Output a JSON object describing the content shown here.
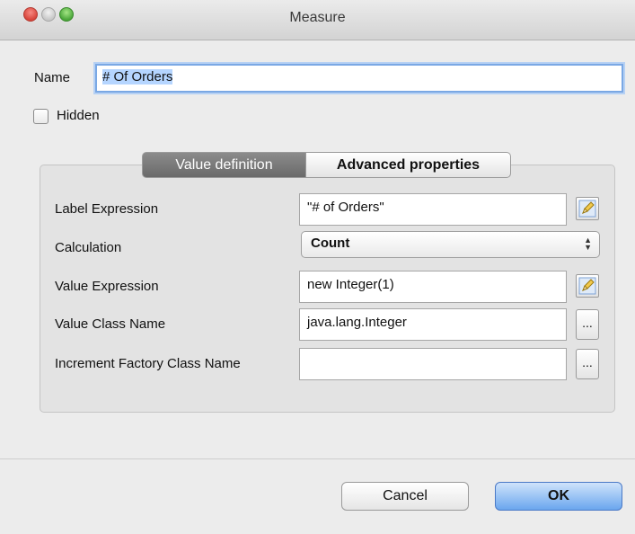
{
  "window": {
    "title": "Measure"
  },
  "name_row": {
    "label": "Name",
    "value": "# Of Orders"
  },
  "hidden": {
    "label": "Hidden",
    "checked": false
  },
  "tabs": [
    {
      "label": "Value definition",
      "active": true
    },
    {
      "label": "Advanced properties",
      "active": false
    }
  ],
  "form": {
    "label_expression": {
      "label": "Label Expression",
      "value": "\"# of Orders\""
    },
    "calculation": {
      "label": "Calculation",
      "value": "Count"
    },
    "value_expression": {
      "label": "Value Expression",
      "value": "new Integer(1)"
    },
    "value_class_name": {
      "label": "Value Class Name",
      "value": "java.lang.Integer"
    },
    "increment_factory": {
      "label": "Increment Factory Class Name",
      "value": ""
    },
    "browse_label": "..."
  },
  "buttons": {
    "cancel": "Cancel",
    "ok": "OK"
  },
  "colors": {
    "accent": "#6aa6ee",
    "focus_ring": "#7aa8e4",
    "active_tab": "#7a7a7a"
  }
}
